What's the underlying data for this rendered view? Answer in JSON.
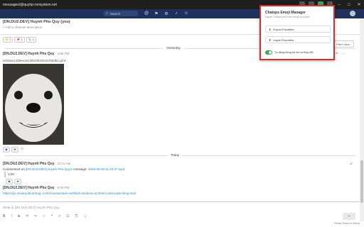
{
  "window": {
    "title": "messages/@quyhp-ronsystem.net"
  },
  "topbar": {
    "search_placeholder": "Search",
    "top_icons": [
      "at-icon",
      "bookmark-icon",
      "gear-icon",
      "bell-icon",
      "user-icon"
    ]
  },
  "header": {
    "channel_name": "[DN.DU2.DEV] Huynh Phu Quy (you)",
    "description": "+ Add a channel description",
    "right_button": "Filter View..."
  },
  "pins": [
    "📁 1",
    "📌 1",
    "📎 1"
  ],
  "separators": {
    "yesterday": "Yesterday",
    "today": "Today"
  },
  "messages": [
    {
      "author": "[DN.DU2.DEV] Huynh Phu Quy",
      "time": "3:56 PM",
      "filename": "d425ae1438ee1513601f5426167b6d51.gif ▾"
    },
    {
      "author": "[DN.DU2.DEV] Huynh Phu Quy",
      "time": "11:21 AM",
      "commented_prefix": "Commented on ",
      "commented_target": "[DN.DU2.DEV] Huynh Phu Quy's",
      "commented_mid": " message: ",
      "commented_file": "2026-06-29 11.23.37.mp4",
      "quote": "1:23"
    },
    {
      "author": "[DN.DU2.DEV] Huynh Phu Quy",
      "time": "9:49 PM",
      "link": "https://go.sunasy.itlearning-.com/courses/aws-certified-solutions-architect-associate-tieng-viet/"
    }
  ],
  "composer": {
    "placeholder": "Write to [DN.DU2.DEV] Huynh Phu Quy",
    "send": "➤",
    "hint": "Press Enter to Send"
  },
  "popup": {
    "title": "Chatops Emoji Manager",
    "subtitle": "Export / import your own emoji you want",
    "export_label": "Export Favorites",
    "import_label": "Import Favorites",
    "toggle_label": "Tự động đồng bộ khi có thay đổi",
    "toggle_on": true,
    "border_color": "#d62d2d"
  },
  "colors": {
    "topbar": "#1e325c",
    "link": "#2389d7",
    "toggle": "#3aa757"
  }
}
